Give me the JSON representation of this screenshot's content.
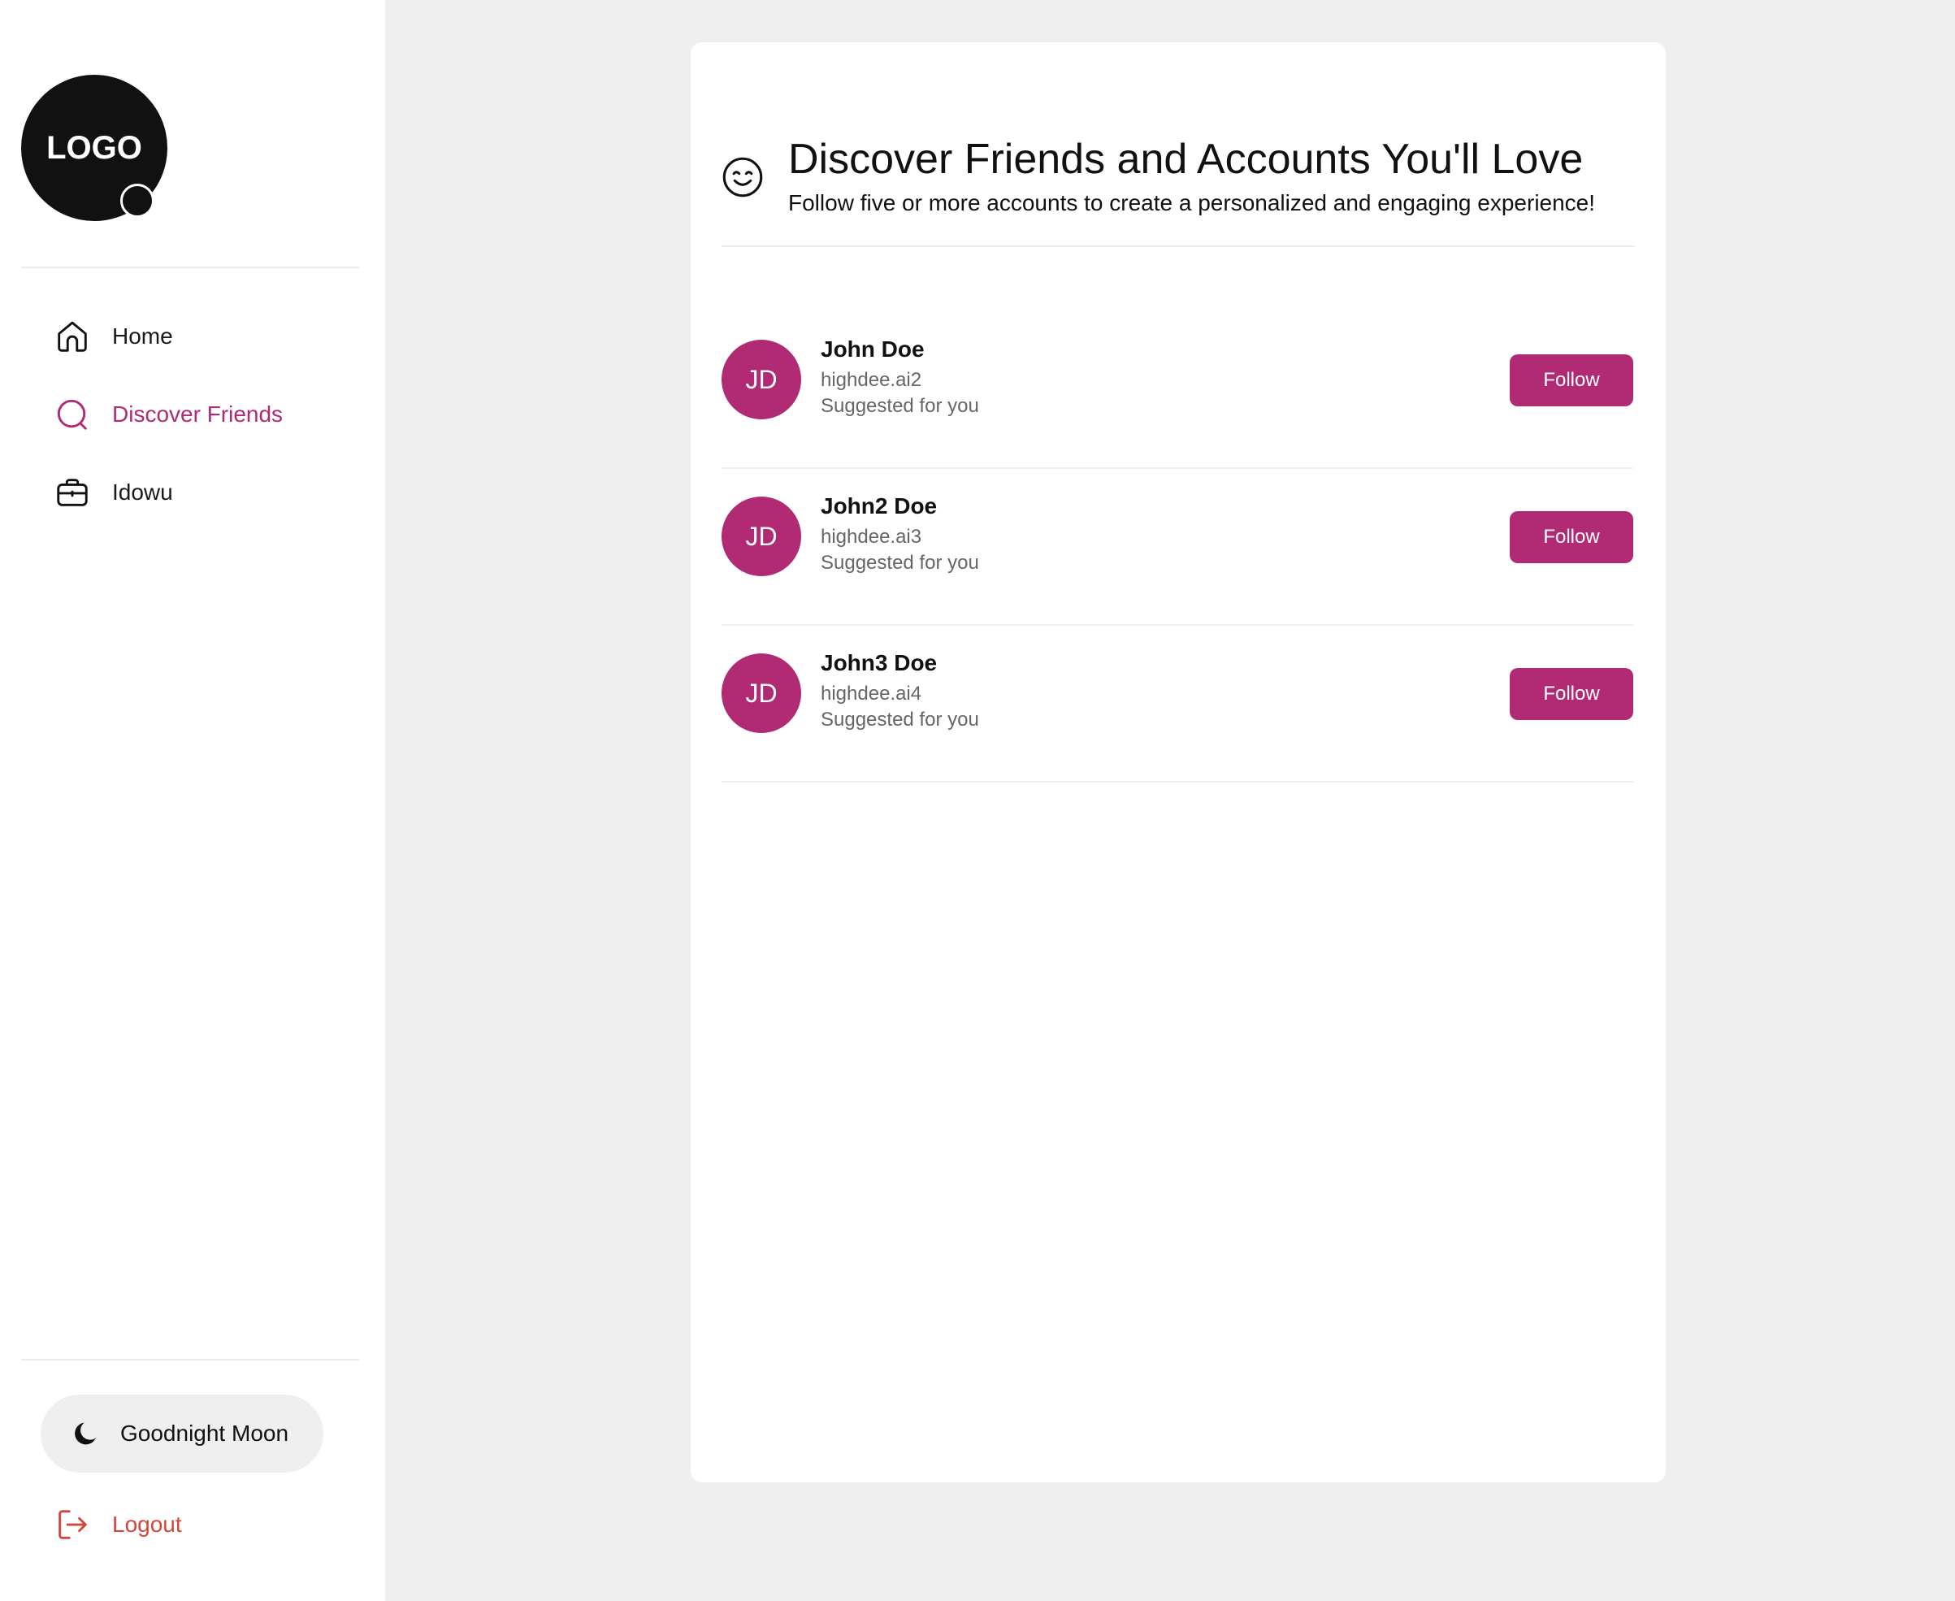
{
  "sidebar": {
    "logo_text": "LOGO",
    "nav": [
      {
        "label": "Home",
        "icon": "home-icon",
        "active": false
      },
      {
        "label": "Discover Friends",
        "icon": "search-icon",
        "active": true
      },
      {
        "label": "Idowu",
        "icon": "briefcase-icon",
        "active": false
      }
    ],
    "theme_toggle_label": "Goodnight Moon",
    "logout_label": "Logout"
  },
  "main": {
    "title": "Discover Friends and Accounts You'll Love",
    "subtitle": "Follow five or more accounts to create a personalized and engaging experience!",
    "suggestions": [
      {
        "initials": "JD",
        "name": "John Doe",
        "handle": "highdee.ai2",
        "note": "Suggested for you",
        "button": "Follow"
      },
      {
        "initials": "JD",
        "name": "John2 Doe",
        "handle": "highdee.ai3",
        "note": "Suggested for you",
        "button": "Follow"
      },
      {
        "initials": "JD",
        "name": "John3 Doe",
        "handle": "highdee.ai4",
        "note": "Suggested for you",
        "button": "Follow"
      }
    ]
  },
  "colors": {
    "accent": "#b12a74",
    "logout": "#d4463a",
    "background": "#efefef"
  }
}
